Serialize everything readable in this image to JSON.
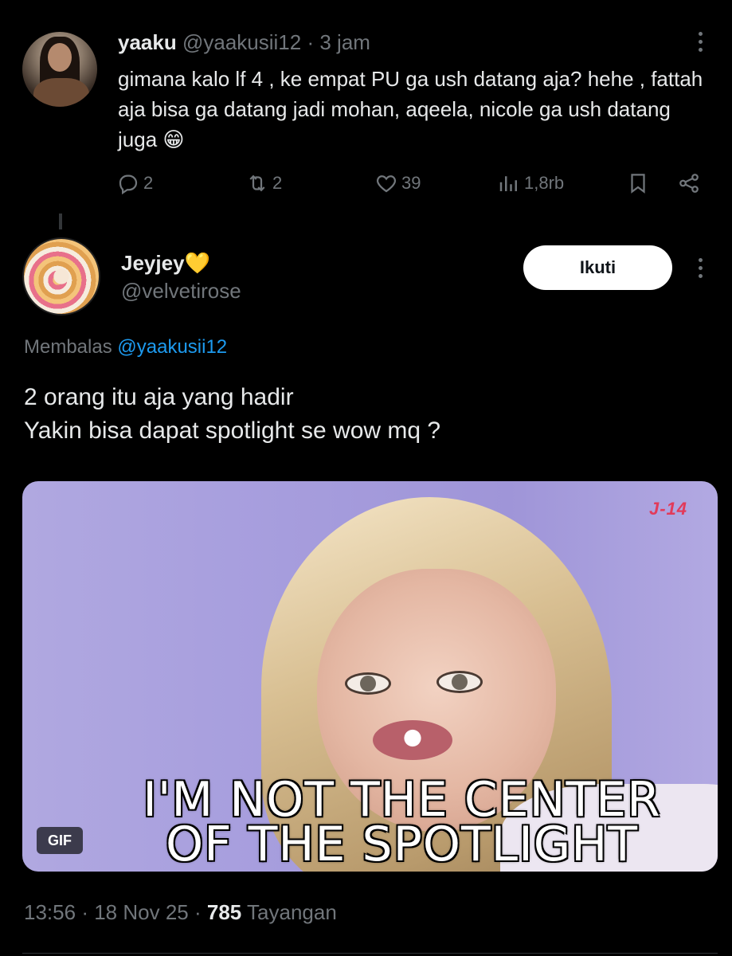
{
  "first_tweet": {
    "name": "yaaku",
    "handle": "@yaakusii12",
    "separator": "·",
    "time": "3 jam",
    "text": "gimana kalo lf 4 , ke empat PU ga ush datang aja? hehe , fattah aja bisa ga datang jadi mohan, aqeela, nicole ga ush datang juga 😁",
    "replies": "2",
    "reposts": "2",
    "likes": "39",
    "views": "1,8rb"
  },
  "second_tweet": {
    "name": "Jeyjey💛",
    "handle": "@velvetirose",
    "follow_label": "Ikuti",
    "reply_prefix": "Membalas",
    "reply_mention": "@yaakusii12",
    "text_line1": "2 orang itu aja yang hadir",
    "text_line2": "Yakin bisa dapat spotlight  se wow mq ?",
    "media": {
      "caption_line1": "I'M NOT THE CENTER",
      "caption_line2": "OF THE SPOTLIGHT",
      "badge": "GIF",
      "watermark": "J-14"
    },
    "time": "13:56",
    "date": "18 Nov 25",
    "views_count": "785",
    "views_label": "Tayangan"
  },
  "colors": {
    "background": "#000000",
    "text_primary": "#e7e9ea",
    "text_secondary": "#71767b",
    "accent": "#1d9bf0"
  }
}
